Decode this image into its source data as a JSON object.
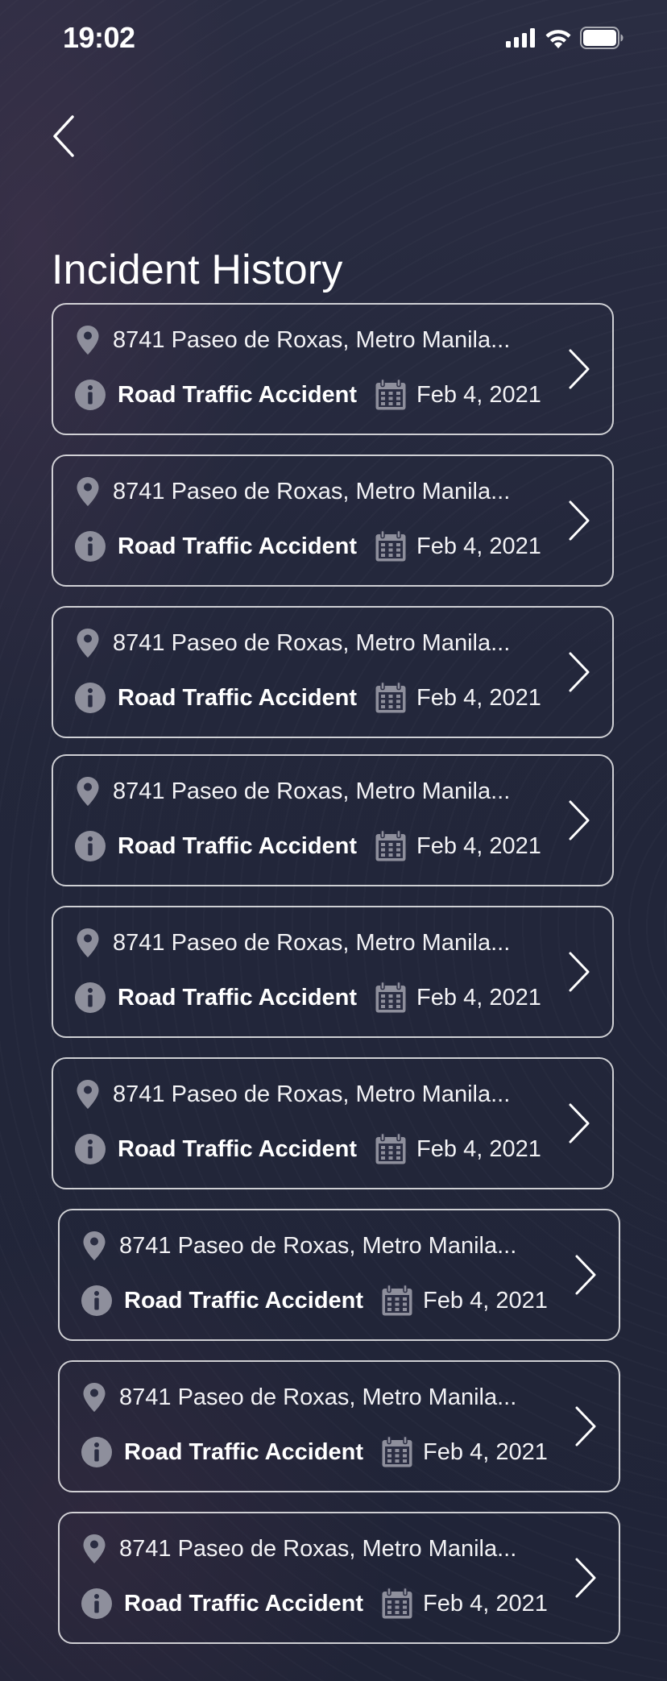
{
  "status_bar": {
    "time": "19:02",
    "icons": [
      "signal-icon",
      "wifi-icon",
      "battery-icon"
    ]
  },
  "header": {
    "back_icon": "chevron-left-icon",
    "title": "Incident History"
  },
  "incidents": [
    {
      "address": "8741 Paseo de Roxas, Metro Manila...",
      "type": "Road Traffic Accident",
      "date": "Feb 4, 2021"
    },
    {
      "address": "8741 Paseo de Roxas, Metro Manila...",
      "type": "Road Traffic Accident",
      "date": "Feb 4, 2021"
    },
    {
      "address": "8741 Paseo de Roxas, Metro Manila...",
      "type": "Road Traffic Accident",
      "date": "Feb 4, 2021"
    },
    {
      "address": "8741 Paseo de Roxas, Metro Manila...",
      "type": "Road Traffic Accident",
      "date": "Feb 4, 2021"
    },
    {
      "address": "8741 Paseo de Roxas, Metro Manila...",
      "type": "Road Traffic Accident",
      "date": "Feb 4, 2021"
    },
    {
      "address": "8741 Paseo de Roxas, Metro Manila...",
      "type": "Road Traffic Accident",
      "date": "Feb 4, 2021"
    },
    {
      "address": "8741 Paseo de Roxas, Metro Manila...",
      "type": "Road Traffic Accident",
      "date": "Feb 4, 2021"
    },
    {
      "address": "8741 Paseo de Roxas, Metro Manila...",
      "type": "Road Traffic Accident",
      "date": "Feb 4, 2021"
    },
    {
      "address": "8741 Paseo de Roxas, Metro Manila...",
      "type": "Road Traffic Accident",
      "date": "Feb 4, 2021"
    }
  ],
  "card_icons": {
    "location": "location-pin-icon",
    "info": "info-icon",
    "calendar": "calendar-icon",
    "open": "chevron-right-icon"
  },
  "colors": {
    "background": "#22263a",
    "icon_gray": "#8e8f9c",
    "card_border": "#ffffff",
    "text": "#ffffff"
  }
}
